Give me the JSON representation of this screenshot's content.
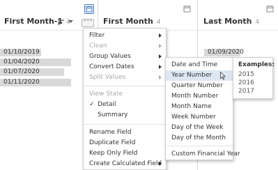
{
  "columns": [
    {
      "name": "First Month-1",
      "count": "4"
    },
    {
      "name": "First Month",
      "count": "4"
    },
    {
      "name": "Last Month",
      "count": "4"
    }
  ],
  "first_col_values": [
    "01/10/2019",
    "01/04/2020",
    "01/07/2020",
    "01/11/2020"
  ],
  "last_col_values": [
    "01/09/2020"
  ],
  "more_label": "···",
  "context_menu": {
    "items": [
      {
        "label": "Filter",
        "disabled": false,
        "submenu": true
      },
      {
        "label": "Clean",
        "disabled": true,
        "submenu": true
      },
      {
        "label": "Group Values",
        "disabled": false,
        "submenu": true
      },
      {
        "label": "Convert Dates",
        "disabled": false,
        "submenu": true
      },
      {
        "label": "Split Values",
        "disabled": true,
        "submenu": true
      },
      {
        "label": "View State",
        "disabled": true,
        "submenu": false
      },
      {
        "label": "Detail",
        "disabled": false,
        "submenu": false,
        "checked": true
      },
      {
        "label": "Summary",
        "disabled": false,
        "submenu": false
      },
      {
        "label": "Rename Field",
        "disabled": false,
        "submenu": false
      },
      {
        "label": "Duplicate Field",
        "disabled": false,
        "submenu": false
      },
      {
        "label": "Keep Only Field",
        "disabled": false,
        "submenu": false
      },
      {
        "label": "Create Calculated Field",
        "disabled": false,
        "submenu": true
      }
    ],
    "check_glyph": "✓"
  },
  "convert_dates_submenu": {
    "items": [
      "Date and Time",
      "Year Number",
      "Quarter Number",
      "Month Number",
      "Month Name",
      "Week Number",
      "Day of the Week",
      "Day of the Month",
      "Custom Financial Year"
    ],
    "selected": "Year Number"
  },
  "examples": {
    "title": "Examples:",
    "values": [
      "2015",
      "2016",
      "2017"
    ]
  },
  "colors": {
    "bar": "#d9d9d9",
    "selected": "#dde7f3",
    "icon": "#8a8a8a",
    "accent": "#4a7fbf"
  },
  "icons": [
    "calendar-icon",
    "sort-icon",
    "chevron-down-icon",
    "more-options-icon",
    "cursor-icon"
  ]
}
